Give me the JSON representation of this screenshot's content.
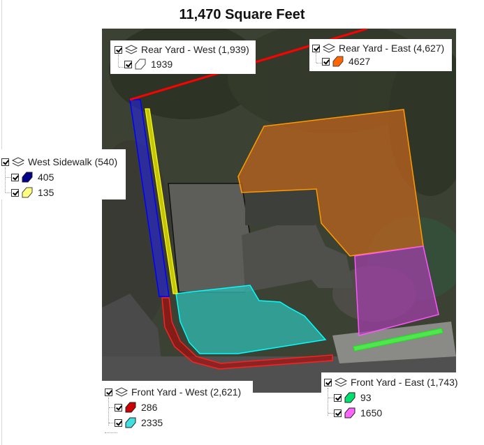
{
  "title": "11,470 Square Feet",
  "legends": {
    "rear_west": {
      "group_label": "Rear Yard - West (1,939)",
      "items": [
        {
          "label": "1939",
          "color": "#ffffff",
          "icon": "polygon-fill-symbol"
        }
      ]
    },
    "rear_east": {
      "group_label": "Rear Yard - East (4,627)",
      "items": [
        {
          "label": "4627",
          "color": "#ff6600",
          "icon": "polygon-fill-symbol"
        }
      ]
    },
    "west_sidewalk": {
      "group_label": "West Sidewalk (540)",
      "items": [
        {
          "label": "405",
          "color": "#00008b",
          "icon": "polygon-fill-symbol"
        },
        {
          "label": "135",
          "color": "#ffff80",
          "icon": "polygon-fill-symbol"
        }
      ]
    },
    "front_west": {
      "group_label": "Front Yard - West (2,621)",
      "items": [
        {
          "label": "286",
          "color": "#cc0000",
          "icon": "polygon-fill-symbol"
        },
        {
          "label": "2335",
          "color": "#40e0e0",
          "icon": "polygon-fill-symbol"
        }
      ]
    },
    "front_east": {
      "group_label": "Front Yard - East (1,743)",
      "items": [
        {
          "label": "93",
          "color": "#00e070",
          "icon": "polygon-fill-symbol"
        },
        {
          "label": "1650",
          "color": "#ff66ff",
          "icon": "polygon-fill-symbol"
        }
      ]
    }
  },
  "colors": {
    "rear_east_fill": "#c8661e",
    "front_west_fill": "#2fbcb4",
    "front_east_fill": "#a040a8",
    "sidewalk_blue": "#1a1aff",
    "sidewalk_yellow": "#ffff00",
    "property_line": "#ff0000"
  }
}
